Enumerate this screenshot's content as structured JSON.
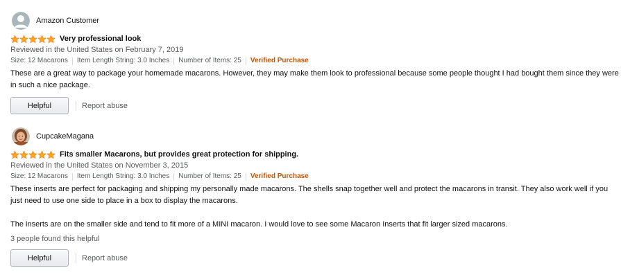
{
  "colors": {
    "star": "#ffa41c",
    "verified": "#c45500",
    "secondary_text": "#565959"
  },
  "reviews": [
    {
      "profile_name": "Amazon Customer",
      "avatar": "default-avatar-icon",
      "rating": 5,
      "title": "Very professional look",
      "date": "Reviewed in the United States on February 7, 2019",
      "format": {
        "size": "Size: 12 Macarons",
        "length": "Item Length String: 3.0 Inches",
        "items": "Number of Items: 25"
      },
      "verified": "Verified Purchase",
      "body": [
        "These are a great way to package your homemade macarons. However, they may make them look to professional because some people thought I had bought them since they were in such a nice package."
      ],
      "helpful_count": "",
      "helpful_label": "Helpful",
      "report_label": "Report abuse"
    },
    {
      "profile_name": "CupcakeMagana",
      "avatar": "user-photo-avatar",
      "rating": 5,
      "title": "Fits smaller Macarons, but provides great protection for shipping.",
      "date": "Reviewed in the United States on November 3, 2015",
      "format": {
        "size": "Size: 12 Macarons",
        "length": "Item Length String: 3.0 Inches",
        "items": "Number of Items: 25"
      },
      "verified": "Verified Purchase",
      "body": [
        "These inserts are perfect for packaging and shipping my personally made macarons. The shells snap together well and protect the macarons in transit. They also work well if you just need to use one side to place in a box to display the macarons.",
        "The inserts are on the smaller side and tend to fit more of a MINI macaron. I would love to see some Macaron Inserts that fit larger sized macarons."
      ],
      "helpful_count": "3 people found this helpful",
      "helpful_label": "Helpful",
      "report_label": "Report abuse"
    }
  ]
}
